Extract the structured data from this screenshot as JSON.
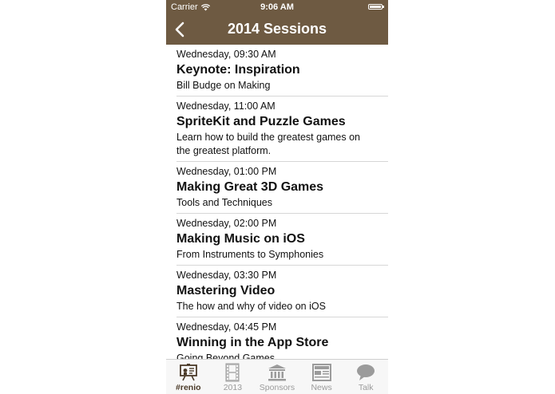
{
  "status_bar": {
    "carrier": "Carrier",
    "time": "9:06 AM"
  },
  "nav": {
    "title": "2014 Sessions",
    "back_icon": "chevron-left-icon"
  },
  "sessions": [
    {
      "time": "Wednesday, 09:30 AM",
      "title": "Keynote: Inspiration",
      "subtitle": "Bill Budge on Making"
    },
    {
      "time": "Wednesday, 11:00 AM",
      "title": "SpriteKit and Puzzle Games",
      "subtitle": "Learn how to build the greatest games on the greatest platform."
    },
    {
      "time": "Wednesday, 01:00 PM",
      "title": "Making Great 3D Games",
      "subtitle": "Tools and Techniques"
    },
    {
      "time": "Wednesday, 02:00 PM",
      "title": "Making Music on iOS",
      "subtitle": "From Instruments to Symphonies"
    },
    {
      "time": "Wednesday, 03:30 PM",
      "title": "Mastering Video",
      "subtitle": "The how and why of video on iOS"
    },
    {
      "time": "Wednesday, 04:45 PM",
      "title": "Winning in the App Store",
      "subtitle": "Going Beyond Games"
    }
  ],
  "tabs": [
    {
      "label": "#renio",
      "icon": "presentation-icon",
      "active": true
    },
    {
      "label": "2013",
      "icon": "film-strip-icon",
      "active": false
    },
    {
      "label": "Sponsors",
      "icon": "bank-building-icon",
      "active": false
    },
    {
      "label": "News",
      "icon": "newspaper-icon",
      "active": false
    },
    {
      "label": "Talk",
      "icon": "speech-bubble-icon",
      "active": false
    }
  ],
  "colors": {
    "bar_brown": "#6e5a42",
    "tab_active": "#4a3a28",
    "tab_inactive": "#9b9b9b"
  }
}
